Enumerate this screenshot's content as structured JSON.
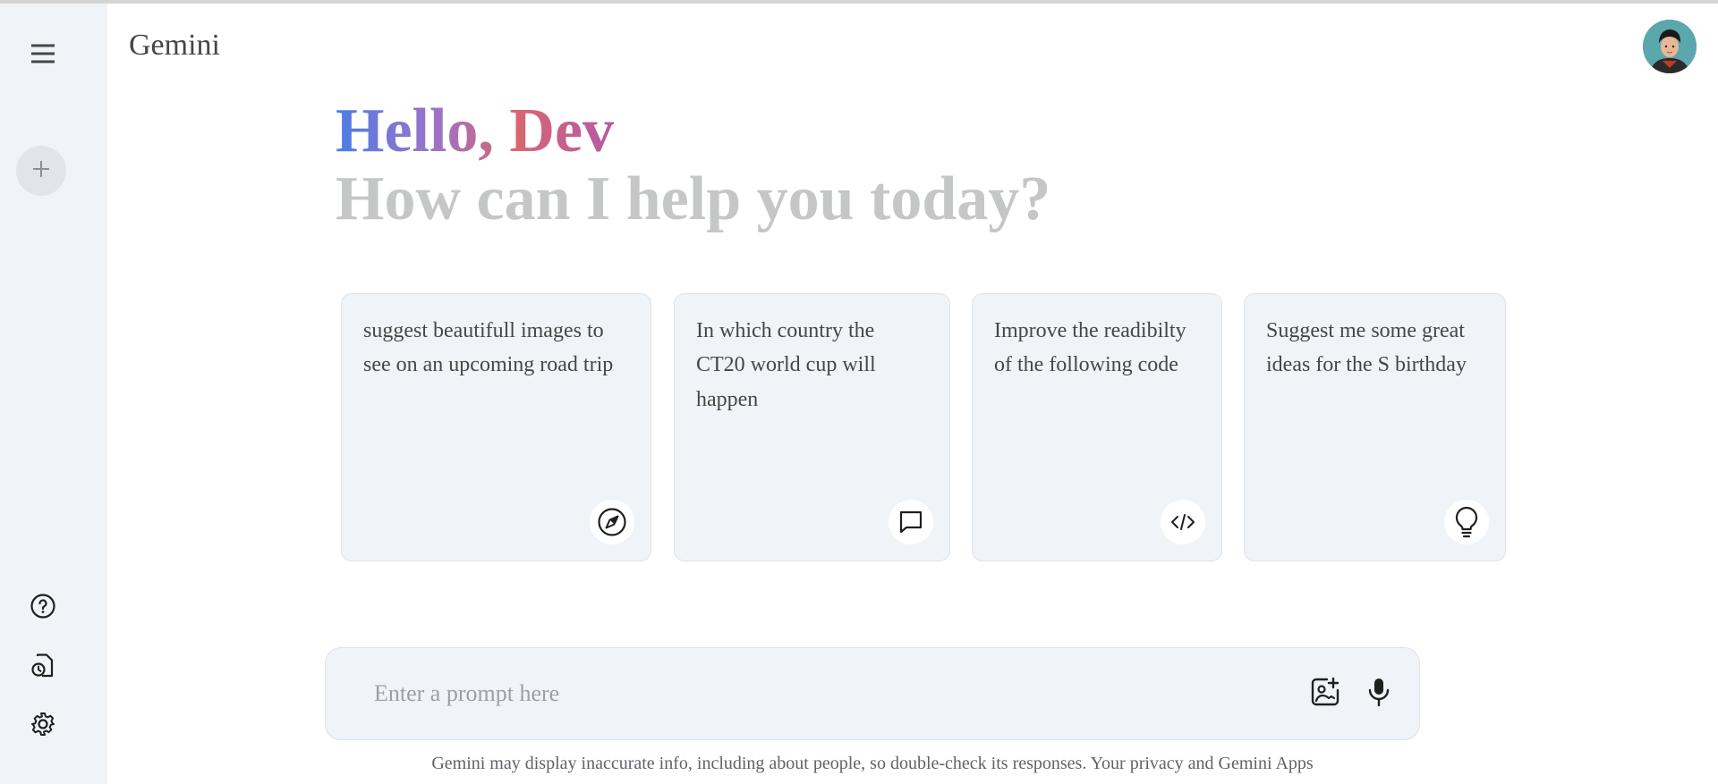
{
  "app": {
    "title": "Gemini"
  },
  "sidebar": {
    "menu_icon": "menu-icon",
    "new_chat_icon": "plus-icon",
    "bottom_icons": [
      "help-icon",
      "activity-icon",
      "settings-icon"
    ]
  },
  "greeting": {
    "hello": "Hello, Dev",
    "subtitle": "How can I help you today?"
  },
  "cards": [
    {
      "text": "suggest beautifull images to see on an upcoming road trip",
      "icon": "compass-icon"
    },
    {
      "text": "In which country the CT20 world cup will happen",
      "icon": "chat-icon"
    },
    {
      "text": "Improve the readibilty of the following code",
      "icon": "code-icon"
    },
    {
      "text": "Suggest me some great ideas for the S birthday",
      "icon": "bulb-icon"
    }
  ],
  "prompt": {
    "placeholder": "Enter a prompt here",
    "value": "",
    "icons": [
      "image-upload-icon",
      "mic-icon"
    ]
  },
  "disclaimer": "Gemini may display inaccurate info, including about people, so double-check its responses. Your privacy and Gemini Apps",
  "colors": {
    "sidebar_bg": "#f0f4f9",
    "card_bg": "#f0f4f9",
    "subtitle": "#c4c7c5",
    "gradient_start": "#4c7ee3",
    "gradient_end": "#d96570"
  }
}
